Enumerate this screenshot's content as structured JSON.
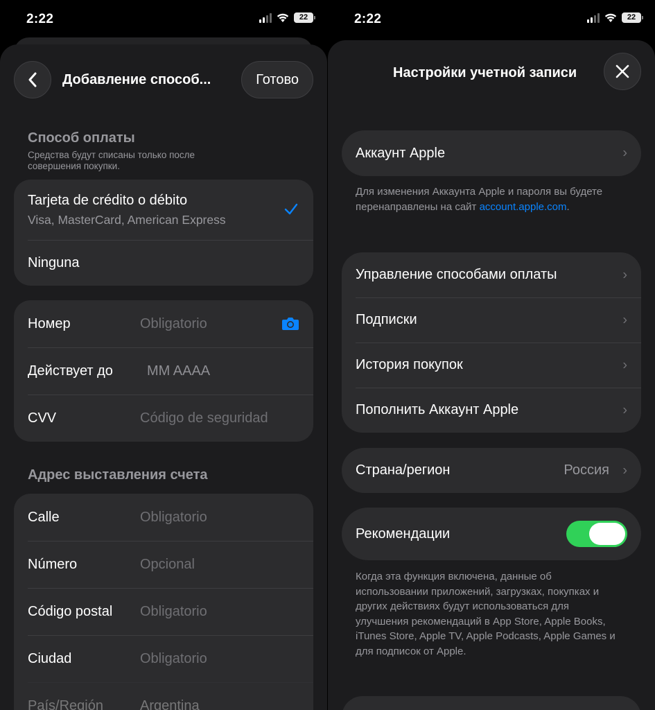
{
  "status_bar": {
    "time": "2:22",
    "battery": "22"
  },
  "left": {
    "nav": {
      "title": "Добавление способ...",
      "done_label": "Готово"
    },
    "payment": {
      "title": "Способ оплаты",
      "subtitle": "Средства будут списаны только после совершения покупки.",
      "options": [
        {
          "label": "Tarjeta de crédito o débito",
          "detail": "Visa, MasterCard, American Express",
          "selected": true
        },
        {
          "label": "Ninguna"
        }
      ]
    },
    "card_fields": [
      {
        "label": "Номер",
        "placeholder": "Obligatorio"
      },
      {
        "label": "Действует до",
        "placeholder": "MM AAAA"
      },
      {
        "label": "CVV",
        "placeholder": "Código de seguridad"
      }
    ],
    "billing": {
      "title": "Адрес выставления счета",
      "fields": [
        {
          "label": "Calle",
          "placeholder": "Obligatorio"
        },
        {
          "label": "Número",
          "placeholder": "Opcional"
        },
        {
          "label": "Código postal",
          "placeholder": "Obligatorio"
        },
        {
          "label": "Ciudad",
          "placeholder": "Obligatorio"
        },
        {
          "label": "País/Región",
          "value": "Argentina"
        }
      ]
    }
  },
  "right": {
    "nav": {
      "title": "Настройки учетной записи"
    },
    "apple_account": {
      "label": "Аккаунт Apple",
      "note": "Для изменения Аккаунта Apple и пароля вы будете перенаправлены на сайт",
      "note_link": "account.apple.com",
      "note_end": "."
    },
    "menu": [
      {
        "label": "Управление способами оплаты"
      },
      {
        "label": "Подписки"
      },
      {
        "label": "История покупок"
      },
      {
        "label": "Пополнить Аккаунт Apple"
      }
    ],
    "country": {
      "label": "Страна/регион",
      "value": "Россия"
    },
    "recommendations": {
      "label": "Рекомендации",
      "enabled": true,
      "note": "Когда эта функция включена, данные об использовании приложений, загрузках, покупках и других действиях будут использоваться для улучшения рекомендаций в App Store, Apple Books, iTunes Store, Apple TV, Apple Podcasts, Apple Games и для подписок от Apple."
    }
  },
  "colors": {
    "accent": "#0a84ff",
    "toggle_on": "#30d158",
    "group_bg": "#2c2c2e",
    "sheet_bg": "#1c1c1e"
  }
}
